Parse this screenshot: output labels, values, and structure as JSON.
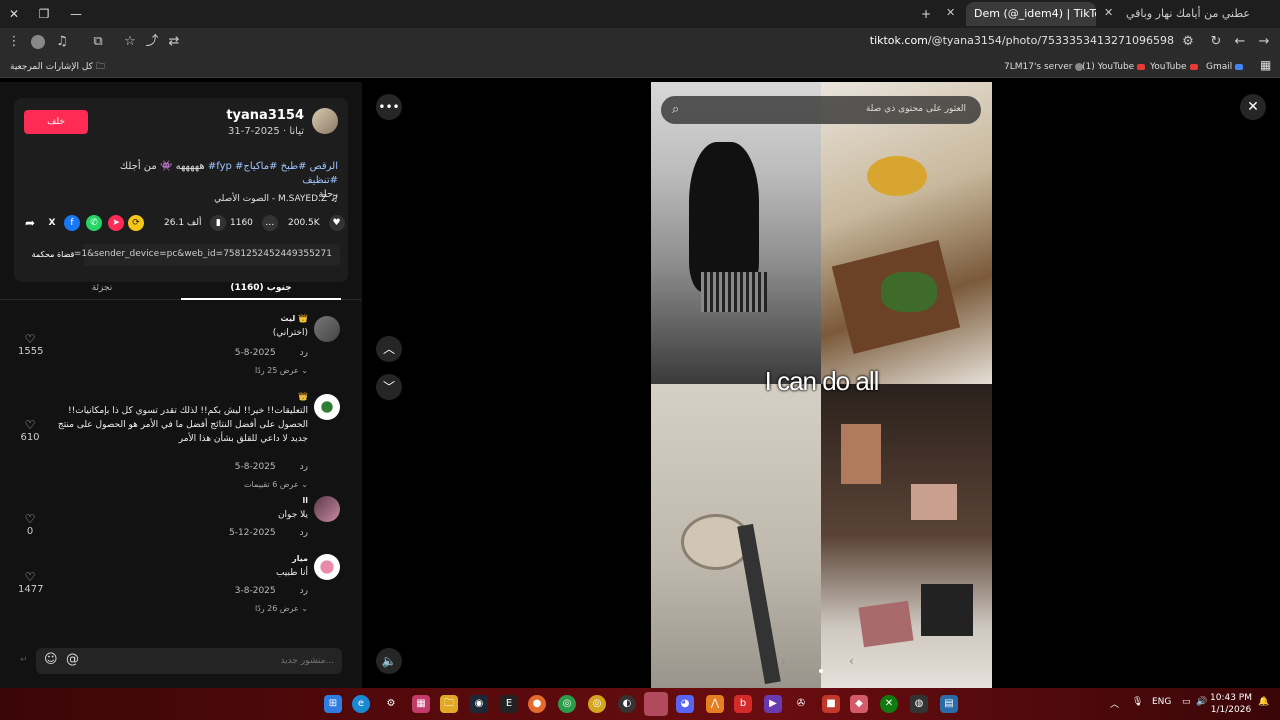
{
  "browser": {
    "tabs": [
      {
        "title": "Dem (@_idem4) | TikTok(1)",
        "active": true
      },
      {
        "title": "عطني من أيامك نهار وباقي cloud",
        "active": false
      }
    ],
    "url_host": "tiktok.com",
    "url_path": "/@tyana3154/photo/7533353413271096598",
    "bookmarks_folder": "كل الإشارات المرجعية",
    "bookmarks": [
      "7LM17's server",
      "(1) YouTube",
      "YouTube",
      "Gmail"
    ]
  },
  "post": {
    "username": "tyana3154",
    "date_line": "تيانا · 2025-7-31",
    "follow_label": "خلف",
    "caption_plain": "هههههه 👾 من أجلك",
    "caption_tags": "#fyp #الرقص #طبخ #ماكياج #تنظيف",
    "caption_line2": "رحلة",
    "music": "الصوت الأصلي - M.SAYED.Z",
    "likes": "200.5K",
    "comments": "1160",
    "saves": "26.1 ألف",
    "copy_label": "قضاة محكمة",
    "link": "...=1&sender_device=pc&web_id=7581252452449355271",
    "tab_comments": "جنوب (1160)",
    "tab_creator": "نجزئة"
  },
  "comments": [
    {
      "name": "ليث 👑",
      "text": "(اختراني)",
      "date": "2025-8-5",
      "reply": "رد",
      "more": "عرض 25 ردًا",
      "likes": "1555"
    },
    {
      "name": "👑",
      "text": "التعليقات!! خير!! ليش بكم!! لذلك تقدر تسوي كل ذا بإمكانيات!! الحصول على أفضل النتائج أفضل ما في الأمر هو الحصول على منتج جديد لا داعي للقلق بشأن هذا الأمر",
      "date": "2025-8-5",
      "reply": "رد",
      "more": "عرض 6 تقييمات",
      "likes": "610"
    },
    {
      "name": "ll",
      "text": "يلا جوان",
      "date": "2025-12-5",
      "reply": "رد",
      "more": "",
      "likes": "0"
    },
    {
      "name": "ميار",
      "text": "أنا طبيب",
      "date": "2025-8-3",
      "reply": "رد",
      "more": "عرض 26 ردًا",
      "likes": "1477"
    }
  ],
  "composer": {
    "placeholder": "منشور جديد..."
  },
  "viewer": {
    "search_placeholder": "العثور على محتوى ذي صلة",
    "overlay_text": "I can do all"
  },
  "taskbar": {
    "lang": "ENG",
    "time": "10:43 PM",
    "date": "1/1/2026"
  }
}
